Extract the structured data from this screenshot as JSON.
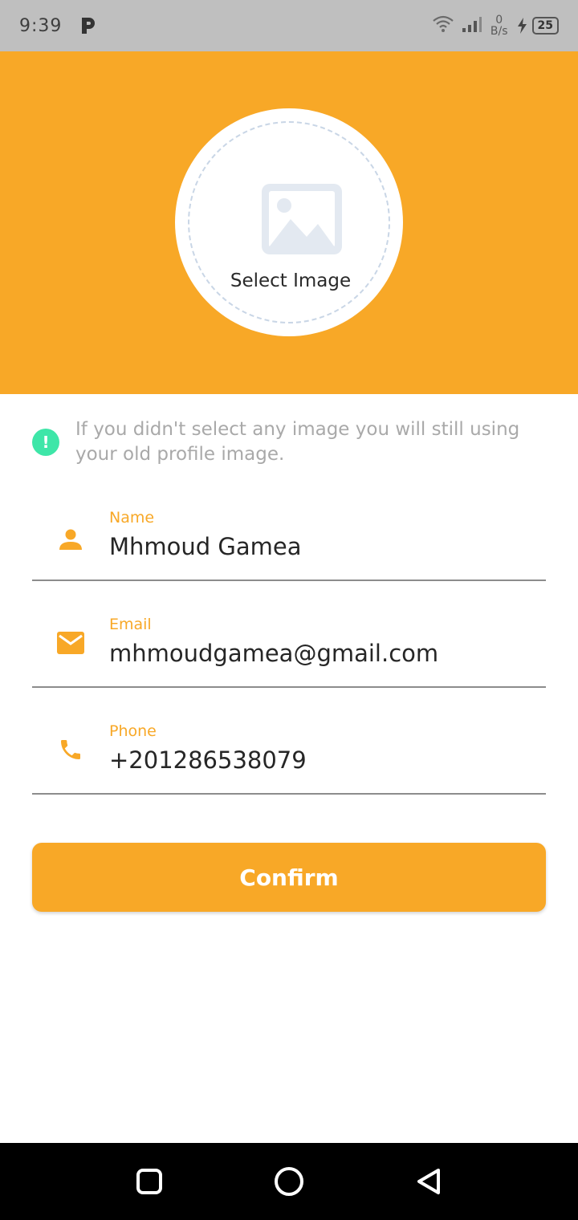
{
  "status_bar": {
    "time": "9:39",
    "net_speed_value": "0",
    "net_speed_unit": "B/s",
    "battery": "25"
  },
  "header": {
    "select_image_label": "Select Image"
  },
  "notice": {
    "text": "If you didn't select any image you will still using your old profile image."
  },
  "form": {
    "name": {
      "label": "Name",
      "value": "Mhmoud Gamea"
    },
    "email": {
      "label": "Email",
      "value": "mhmoudgamea@gmail.com"
    },
    "phone": {
      "label": "Phone",
      "value": "+201286538079"
    }
  },
  "confirm_label": "Confirm",
  "colors": {
    "accent": "#f8a827",
    "notice_icon": "#3ee6a8"
  }
}
